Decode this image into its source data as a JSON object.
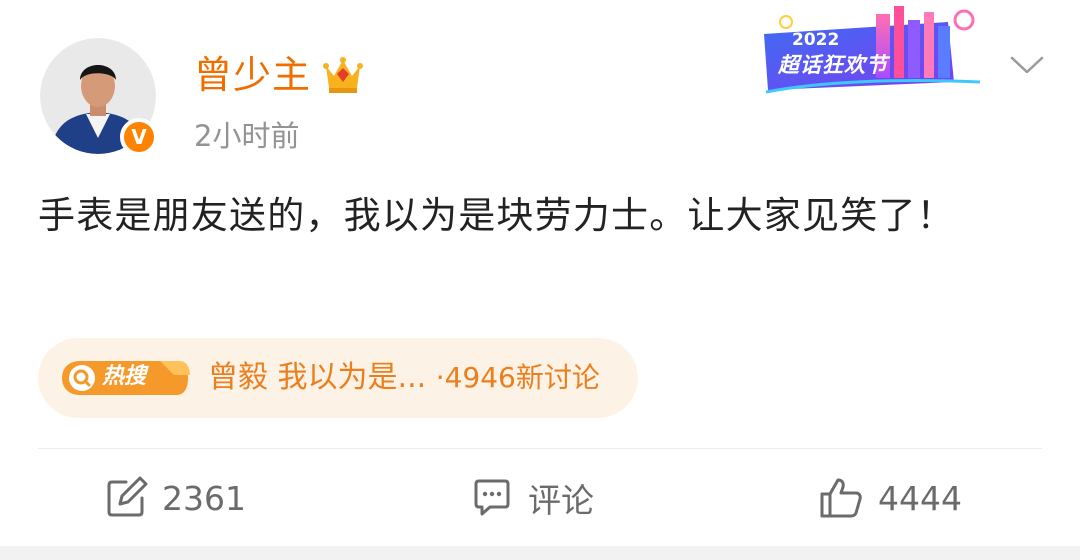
{
  "post": {
    "author": {
      "name": "曾少主",
      "verified_badge": "V",
      "avatar_icon": "avatar",
      "crown_icon": "crown-icon"
    },
    "timestamp": "2小时前",
    "banner": {
      "year": "2022",
      "label": "超话狂欢节"
    },
    "text": "手表是朋友送的，我以为是块劳力士。让大家见笑了！"
  },
  "hot_search": {
    "icon_label": "热搜",
    "topic": "曾毅 我以为是...",
    "discussions": "·4946新讨论"
  },
  "actions": {
    "repost_count": "2361",
    "comment_label": "评论",
    "like_count": "4444"
  },
  "colors": {
    "username": "#f06e00",
    "badge": "#ff8200",
    "hot_bg": "#fdf2e6",
    "hot_text": "#eb7f1e",
    "body_text": "#222222",
    "meta_text": "#939393",
    "action_text": "#6b6b6b"
  }
}
